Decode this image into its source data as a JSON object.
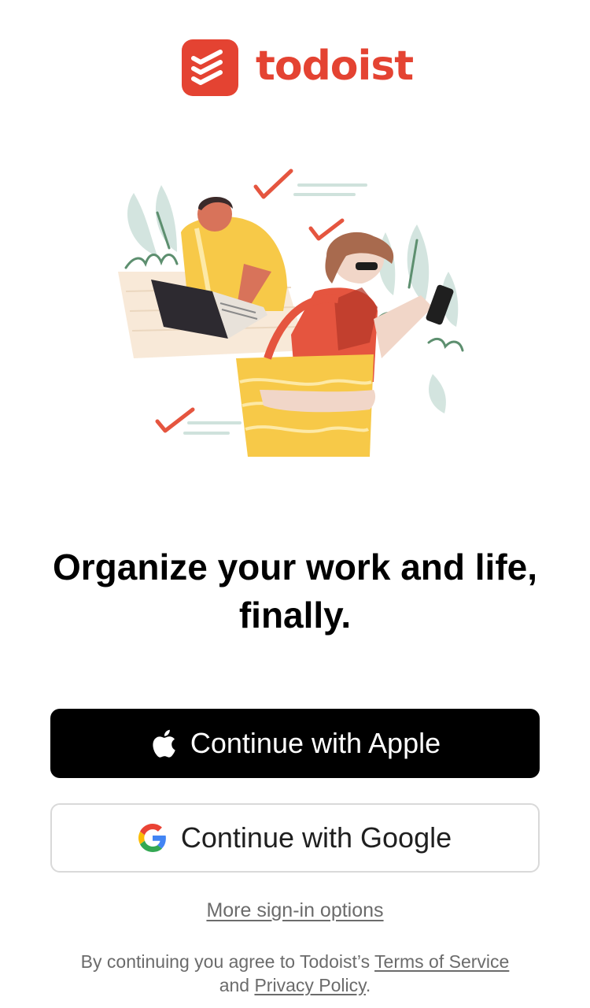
{
  "brand": {
    "name": "todoist",
    "color": "#e44332"
  },
  "illustration": {
    "description_icon": "people-with-tasks-illustration"
  },
  "headline": "Organize your work and life, finally.",
  "buttons": {
    "apple": {
      "label": "Continue with Apple",
      "icon": "apple-icon",
      "background": "#000000",
      "text_color": "#ffffff"
    },
    "google": {
      "label": "Continue with Google",
      "icon": "google-icon",
      "background": "#ffffff",
      "border_color": "#d9d9d9"
    }
  },
  "more_options": {
    "label": "More sign-in options"
  },
  "legal": {
    "prefix": "By continuing you agree to Todoist’s ",
    "terms_label": "Terms of Service",
    "middle": " and ",
    "privacy_label": "Privacy Policy",
    "suffix": "."
  }
}
